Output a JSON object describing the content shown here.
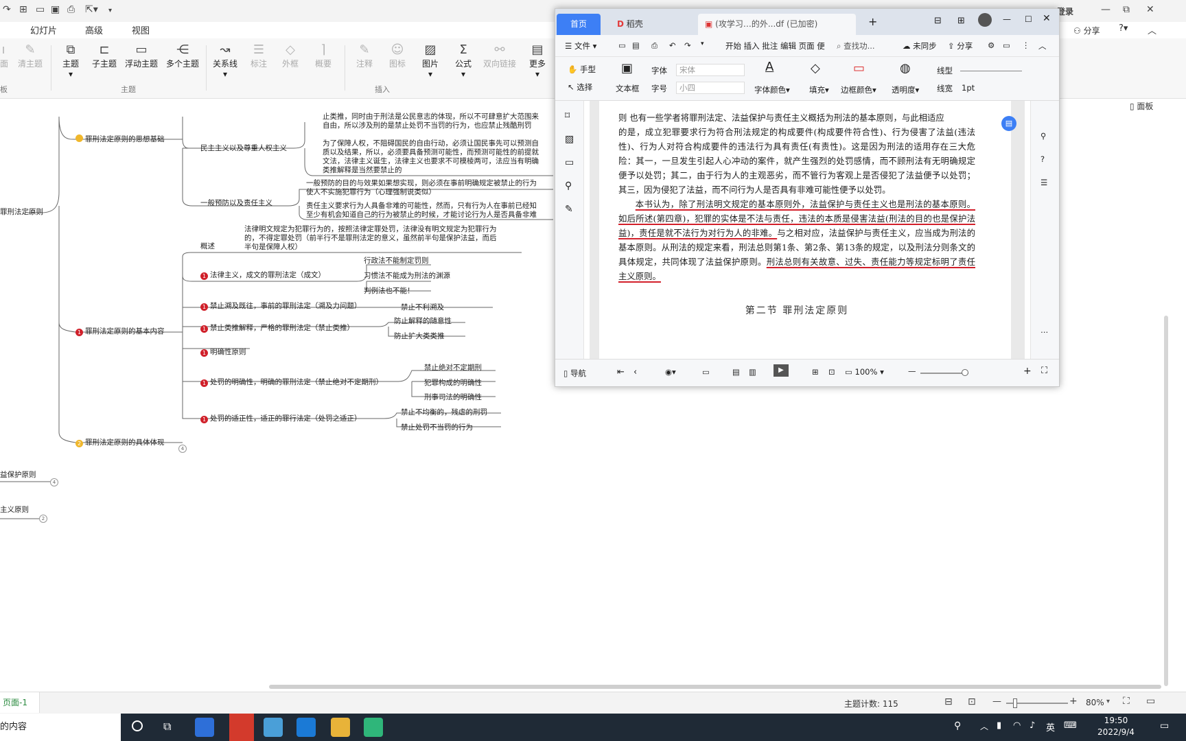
{
  "mindmap": {
    "menu": [
      "幻灯片",
      "高级",
      "视图"
    ],
    "ribbon": {
      "left_cut": [
        "清主题"
      ],
      "buttons": [
        "主题",
        "子主题",
        "浮动主题",
        "多个主题",
        "关系线",
        "标注",
        "外框",
        "概要",
        "注释",
        "图标",
        "图片",
        "公式",
        "双向链接",
        "更多"
      ],
      "groups": [
        "主题",
        "插入"
      ],
      "right": {
        "login": "登录",
        "share": "分享",
        "panel": "面板"
      }
    },
    "nodes": {
      "root_cut": "罪刑法定原则",
      "ideology": "罪刑法定原则的思想基础",
      "democracy": "民主主义以及尊重人权主义",
      "democracy_text1": "止类推，同时由于刑法是公民意志的体现，所以不可肆意扩大范围来\n自由，所以涉及刑的是禁止处罚不当罚的行为，也应禁止残酷刑罚",
      "democracy_text2": "为了保障人权，不阻碍国民的自由行动，必须让国民事先可以预测自\n质以及结果，所以，必须要具备预测可能性，而预测可能性的前提就\n文法，法律主义诞生，法律主义也要求不可模棱两可，法应当有明确\n类推解释是当然要禁止的",
      "prevention": "一般预防以及责任主义",
      "prevention_text1": "一般预防的目的与效果如果想实现，则必须在事前明确规定被禁止的行为\n使人不实施犯罪行为（心理强制说类似）",
      "prevention_text2": "责任主义要求行为人具备非难的可能性，然而，只有行为人在事前已经知\n至少有机会知道自己的行为被禁止的时候，才能讨论行为人是否具备非难",
      "basic": "罪刑法定原则的基本内容",
      "overview": "概述",
      "overview_text": "法律明文规定为犯罪行为的，按照法律定罪处罚，法律没有明文规定为犯罪行为\n的，不得定罪处罚（前半行不是罪刑法定的意义，虽然前半句是保护法益，而后\n半句是保障人权）",
      "legalism": "法律主义，成文的罪刑法定（成文）",
      "legalism_sub": [
        "行政法不能制定罚则",
        "习惯法不能成为刑法的渊源",
        "判例法也不能！"
      ],
      "retro": "禁止溯及既往，事前的罪刑法定（溯及力问题）",
      "retro_sub": [
        "禁止不利溯及"
      ],
      "analogy": "禁止类推解释，严格的罪刑法定（禁止类推）",
      "analogy_sub": [
        "防止解释的随意性",
        "防止扩大类类推"
      ],
      "clarity": "明确性原则",
      "penalty": "处罚的明确性，明确的罪刑法定（禁止绝对不定期刑）",
      "penalty_sub": [
        "禁止绝对不定期刑",
        "犯罪构成的明确性",
        "刑事司法的明确性"
      ],
      "proper": "处罚的适正性，适正的罪行法定（处罚之适正）",
      "proper_sub": [
        "禁止不均衡的，残虐的刑罚",
        "禁止处罚不当罚的行为"
      ],
      "concrete": "罪刑法定原则的具体体现",
      "concrete_count": "4",
      "legal_interest": "益保护原则",
      "legal_interest_count": "4",
      "responsibility": "主义原则",
      "responsibility_count": "2"
    },
    "status": {
      "page": "页面-1",
      "topic_count": "主题计数: 115",
      "zoom": "80%"
    }
  },
  "pdf": {
    "tabs": [
      "首页",
      "稻壳",
      "(攻学习…的外...df (已加密)"
    ],
    "toolbar1": {
      "file": "文件",
      "items": "开始  插入  批注  编辑  页面  便",
      "search": "查找功...",
      "sync": "未同步",
      "share": "分享"
    },
    "toolbar2": {
      "hand": "手型",
      "select": "选择",
      "textbox": "文本框",
      "font_label": "字体",
      "font_value": "宋体",
      "size_label": "字号",
      "size_value": "小四",
      "font_color": "字体颜色",
      "fill": "填充",
      "border_color": "边框颜色",
      "opacity": "透明度",
      "line_type": "线型",
      "line_width": "线宽",
      "line_width_value": "1pt"
    },
    "body": {
      "line1_cut": "则  也有一些学者将罪刑法定、法益保护与责任主义概括为刑法的基本原则，与此相适应",
      "para1": "的是，成立犯罪要求行为符合刑法规定的构成要件(构成要件符合性)、行为侵害了法益(违法性)、行为人对符合构成要件的违法行为具有责任(有责性)。这是因为刑法的适用存在三大危险：其一，一旦发生引起人心冲动的案件，就产生强烈的处罚感情，而不顾刑法有无明确规定便予以处罚；其二，由于行为人的主观恶劣，而不管行为客观上是否侵犯了法益便予以处罚；其三，因为侵犯了法益，而不问行为人是否具有非难可能性便予以处罚。",
      "para2_a": "本书认为，除了刑法明文规定的基本原则外，法益保护与责任主义也是刑法的基本原则。",
      "para2_b": "如后所述(第四章)，犯罪的实体是不法与责任，违法的本质是侵害法益(刑法的目的也是保护法益)，责任是就不法行为对行为人的非难。",
      "para2_c": "与之相对应，法益保护与责任主义，应当成为刑法的基本原则。从刑法的规定来看，刑法总则第1条、第2条、第13条的规定，以及刑法分则条文的具体规定，共同体现了法益保护原则。",
      "para2_d": "刑法总则有关故意、过失、责任能力等规定标明了责任主义原则。",
      "section": "第二节   罪刑法定原则"
    },
    "bottom": {
      "nav": "导航",
      "zoom": "100%"
    }
  },
  "taskbar": {
    "search_text": "的内容",
    "ime": "英",
    "time": "19:50",
    "date": "2022/9/4"
  },
  "colors": {
    "accent_blue": "#3d7ff5",
    "underline_red": "#d21f2a",
    "mind_red": "#d0202a",
    "mind_yellow": "#f0b72b",
    "taskbar": "#1f2a36"
  }
}
